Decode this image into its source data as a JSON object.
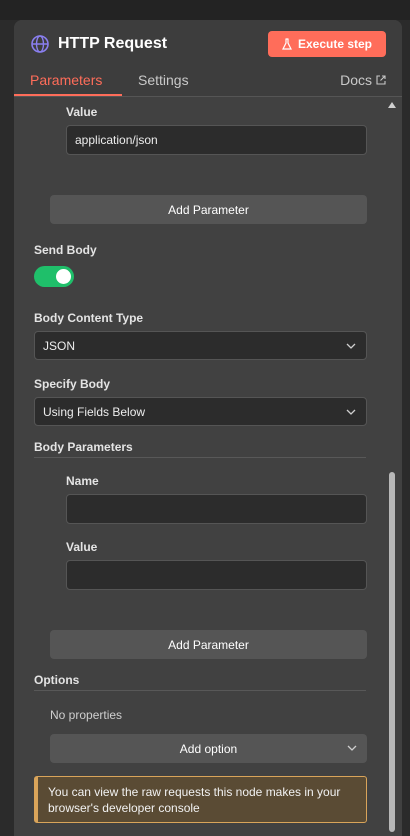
{
  "header": {
    "title": "HTTP Request",
    "execute_label": "Execute step",
    "tabs": [
      "Parameters",
      "Settings"
    ],
    "docs_label": "Docs"
  },
  "headers_section": {
    "value_label": "Value",
    "value": "application/json",
    "add_param_label": "Add Parameter"
  },
  "send_body": {
    "label": "Send Body",
    "enabled": true
  },
  "body_content_type": {
    "label": "Body Content Type",
    "value": "JSON"
  },
  "specify_body": {
    "label": "Specify Body",
    "value": "Using Fields Below"
  },
  "body_parameters": {
    "title": "Body Parameters",
    "name_label": "Name",
    "name_value": "",
    "value_label": "Value",
    "value_value": "",
    "add_param_label": "Add Parameter"
  },
  "options": {
    "title": "Options",
    "empty_text": "No properties",
    "add_option_label": "Add option"
  },
  "notice": {
    "text": "You can view the raw requests this node makes in your browser's developer console"
  },
  "colors": {
    "accent": "#ff6d5a",
    "toggle_on": "#1fbf6a",
    "notice_border": "#d9a45a"
  }
}
